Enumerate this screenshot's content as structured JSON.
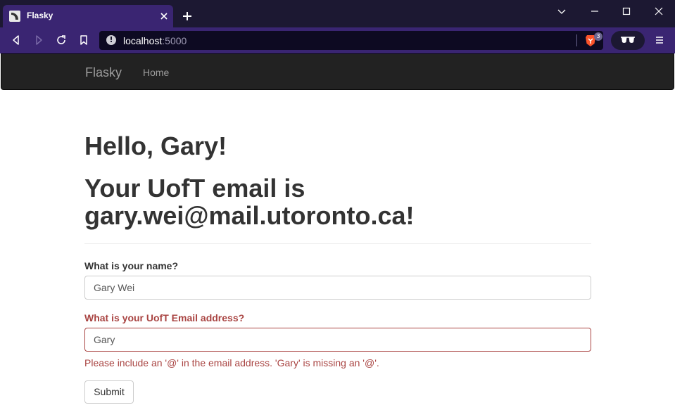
{
  "browser": {
    "tab_title": "Flasky",
    "url_host": "localhost",
    "url_port": ":5000",
    "shields_count": "3",
    "theme_color": "#3a2572"
  },
  "navbar": {
    "brand": "Flasky",
    "links": [
      "Home"
    ]
  },
  "main": {
    "greeting": "Hello, Gary!",
    "email_heading": "Your UofT email is gary.wei@mail.utoronto.ca!"
  },
  "form": {
    "name_label": "What is your name?",
    "name_value": "Gary Wei",
    "email_label": "What is your UofT Email address?",
    "email_value": "Gary",
    "email_error": "Please include an '@' in the email address. 'Gary' is missing an '@'.",
    "submit_label": "Submit",
    "error_color": "#a94442"
  }
}
